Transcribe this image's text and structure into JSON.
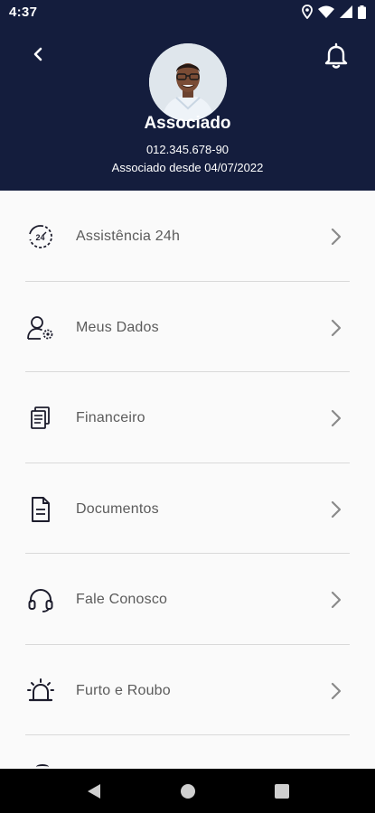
{
  "status_bar": {
    "time": "4:37",
    "icons": [
      "location-icon",
      "wifi-icon",
      "signal-icon",
      "battery-icon"
    ]
  },
  "profile": {
    "name": "Associado",
    "cpf": "012.345.678-90",
    "member_since": "Associado desde 04/07/2022"
  },
  "menu": {
    "items": [
      {
        "label": "Assistência 24h",
        "icon": "assistance-24h-icon"
      },
      {
        "label": "Meus Dados",
        "icon": "user-settings-icon"
      },
      {
        "label": "Financeiro",
        "icon": "finance-documents-icon"
      },
      {
        "label": "Documentos",
        "icon": "document-icon"
      },
      {
        "label": "Fale Conosco",
        "icon": "headset-icon"
      },
      {
        "label": "Furto e Roubo",
        "icon": "alarm-siren-icon"
      }
    ]
  },
  "colors": {
    "header_bg": "#141d3d",
    "icon": "#1c1c2c",
    "label": "#5b5b5b",
    "chevron": "#8a8a8a",
    "background": "#fafafa"
  }
}
